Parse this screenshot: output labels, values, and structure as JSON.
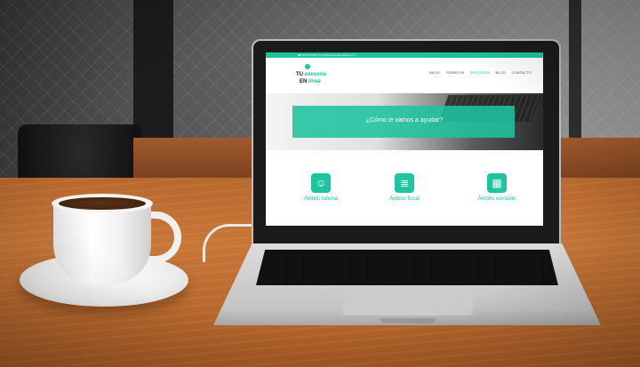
{
  "scene": {
    "description_colors": {
      "accent": "#1ec3a0",
      "table": "#c87736"
    }
  },
  "website": {
    "topbar_contact": "☎ 000 000 000   ✉ info@tuasesoriaenlinea.com   f",
    "logo": {
      "word1": "TU",
      "word2": "asesoría",
      "word3": "EN",
      "word4": "línea"
    },
    "menu": [
      {
        "label": "INICIO",
        "active": false
      },
      {
        "label": "SOBRE MÍ",
        "active": false
      },
      {
        "label": "SERVICIOS",
        "active": true
      },
      {
        "label": "BLOG",
        "active": false
      },
      {
        "label": "CONTACTO",
        "active": false
      }
    ],
    "hero_text": "¿Cómo te vamos a ayudar?",
    "features": [
      {
        "label": "Ámbito laboral",
        "icon": "headset-person-icon",
        "glyph": "☺"
      },
      {
        "label": "Ámbito fiscal",
        "icon": "document-icon",
        "glyph": "≣"
      },
      {
        "label": "Ámbito contable",
        "icon": "calculator-icon",
        "glyph": "▦"
      }
    ]
  }
}
